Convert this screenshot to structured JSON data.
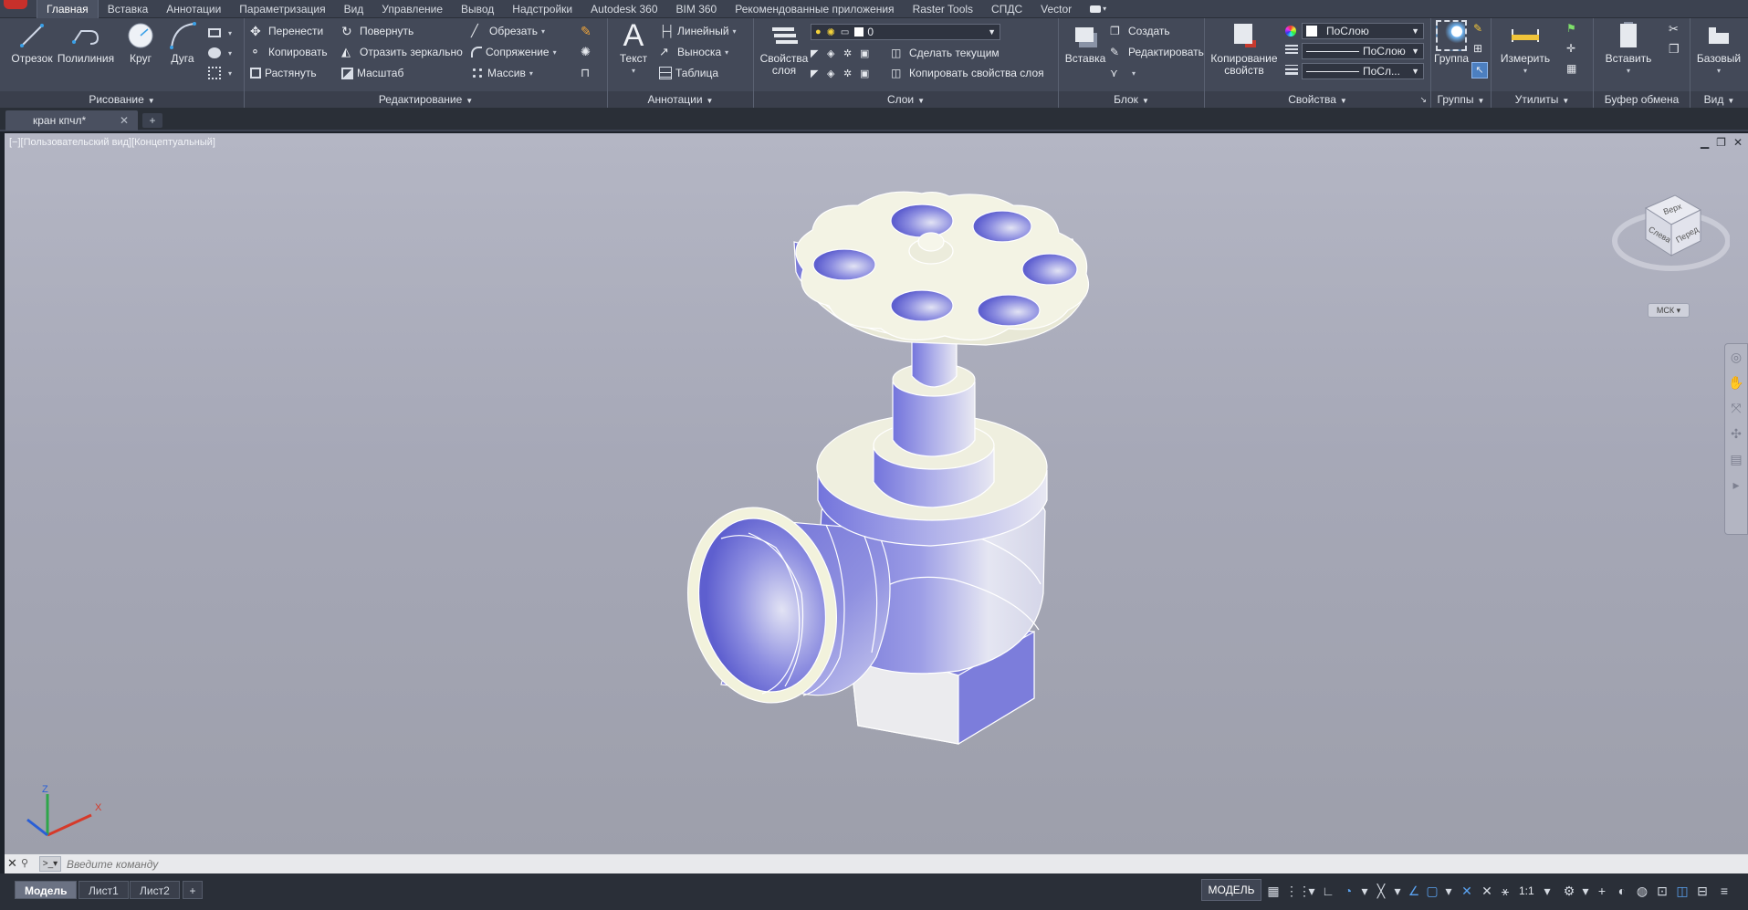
{
  "ribbon_tabs": [
    "Главная",
    "Вставка",
    "Аннотации",
    "Параметризация",
    "Вид",
    "Управление",
    "Вывод",
    "Надстройки",
    "Autodesk 360",
    "BIM 360",
    "Рекомендованные приложения",
    "Raster Tools",
    "СПДС",
    "Vector"
  ],
  "active_tab": "Главная",
  "panels": {
    "draw": {
      "title": "Рисование",
      "line": "Отрезок",
      "polyline": "Полилиния",
      "circle": "Круг",
      "arc": "Дуга"
    },
    "modify": {
      "title": "Редактирование",
      "move": "Перенести",
      "rotate": "Повернуть",
      "trim": "Обрезать",
      "copy": "Копировать",
      "mirror": "Отразить зеркально",
      "fillet": "Сопряжение",
      "stretch": "Растянуть",
      "scale": "Масштаб",
      "array": "Массив"
    },
    "annotation": {
      "title": "Аннотации",
      "text": "Текст",
      "linear": "Линейный",
      "leader": "Выноска",
      "table": "Таблица"
    },
    "layers": {
      "title": "Слои",
      "properties": "Свойства слоя",
      "properties_line1": "Свойства",
      "properties_line2": "слоя",
      "current_layer": "0",
      "make_current": "Сделать текущим",
      "match_layer": "Копировать свойства слоя"
    },
    "block": {
      "title": "Блок",
      "insert": "Вставка",
      "create": "Создать",
      "edit": "Редактировать"
    },
    "properties": {
      "title": "Свойства",
      "match_line1": "Копирование",
      "match_line2": "свойств",
      "color": "ПоСлою",
      "linetype": "ПоСлою",
      "lineweight": "ПоСл..."
    },
    "groups": {
      "title": "Группы",
      "group": "Группа"
    },
    "utilities": {
      "title": "Утилиты",
      "measure": "Измерить"
    },
    "clipboard": {
      "title": "Буфер обмена",
      "paste": "Вставить"
    },
    "view": {
      "title": "Вид",
      "base": "Базовый"
    }
  },
  "document_tab": "кран кпчл*",
  "viewport_label": "[−][Пользовательский вид][Концептуальный]",
  "viewcube": {
    "top": "Верх",
    "left": "Слева",
    "front": "Перед",
    "wcs": "МСК"
  },
  "command_placeholder": "Введите команду",
  "layout_tabs": [
    "Модель",
    "Лист1",
    "Лист2"
  ],
  "status": {
    "model": "МОДЕЛЬ",
    "scale": "1:1"
  },
  "colors": {
    "ribbon": "#434958",
    "viewport_top": "#b4b6c4",
    "model_fill": "#eeeed8",
    "model_shade": "#7f80db"
  }
}
